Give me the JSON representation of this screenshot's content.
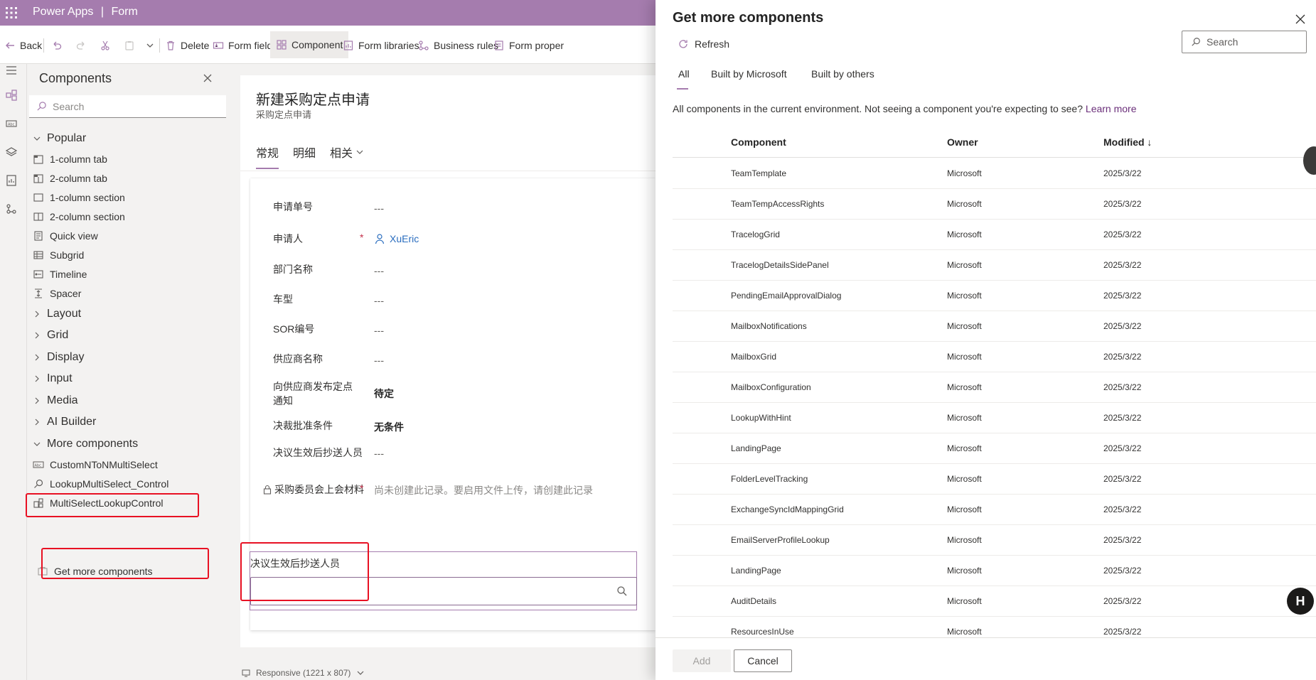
{
  "app": {
    "name": "Power Apps",
    "separator": "|",
    "section": "Form"
  },
  "toolbar": {
    "back": "Back",
    "delete": "Delete",
    "form_field": "Form field",
    "component": "Component",
    "form_libraries": "Form libraries",
    "business_rules": "Business rules",
    "form_properties": "Form proper"
  },
  "components_panel": {
    "title": "Components",
    "search_placeholder": "Search",
    "groups": {
      "popular": "Popular",
      "layout": "Layout",
      "grid": "Grid",
      "display": "Display",
      "input": "Input",
      "media": "Media",
      "ai_builder": "AI Builder",
      "more": "More components"
    },
    "popular_items": [
      "1-column tab",
      "2-column tab",
      "1-column section",
      "2-column section",
      "Quick view",
      "Subgrid",
      "Timeline",
      "Spacer"
    ],
    "more_items": [
      "CustomNToNMultiSelect",
      "LookupMultiSelect_Control",
      "MultiSelectLookupControl"
    ],
    "get_more": "Get more components"
  },
  "form": {
    "title": "新建采购定点申请",
    "subtitle": "采购定点申请",
    "tabs": [
      "常规",
      "明细",
      "相关"
    ],
    "fields": [
      {
        "label": "申请单号",
        "value": "---"
      },
      {
        "label": "申请人",
        "value": "XuEric"
      },
      {
        "label": "部门名称",
        "value": "---"
      },
      {
        "label": "车型",
        "value": "---"
      },
      {
        "label": "SOR编号",
        "value": "---"
      },
      {
        "label": "供应商名称",
        "value": "---"
      },
      {
        "label": "向供应商发布定点通知",
        "value": "待定"
      },
      {
        "label": "决裁批准条件",
        "value": "无条件"
      },
      {
        "label": "决议生效后抄送人员",
        "value": "---"
      },
      {
        "label": "采购委员会上会材料",
        "value": "尚未创建此记录。要启用文件上传，请创建此记录"
      }
    ],
    "required_mark": "*",
    "component_label": "决议生效后抄送人员",
    "responsive": "Responsive (1221 x 807)"
  },
  "dialog": {
    "title": "Get more components",
    "refresh": "Refresh",
    "search_placeholder": "Search",
    "tabs": [
      "All",
      "Built by Microsoft",
      "Built by others"
    ],
    "info": "All components in the current environment. Not seeing a component you're expecting to see?",
    "learn_more": "Learn more",
    "columns": {
      "component": "Component",
      "owner": "Owner",
      "modified": "Modified ↓"
    },
    "rows": [
      {
        "name": "TeamTemplate",
        "owner": "Microsoft",
        "modified": "2025/3/22"
      },
      {
        "name": "TeamTempAccessRights",
        "owner": "Microsoft",
        "modified": "2025/3/22"
      },
      {
        "name": "TracelogGrid",
        "owner": "Microsoft",
        "modified": "2025/3/22"
      },
      {
        "name": "TracelogDetailsSidePanel",
        "owner": "Microsoft",
        "modified": "2025/3/22"
      },
      {
        "name": "PendingEmailApprovalDialog",
        "owner": "Microsoft",
        "modified": "2025/3/22"
      },
      {
        "name": "MailboxNotifications",
        "owner": "Microsoft",
        "modified": "2025/3/22"
      },
      {
        "name": "MailboxGrid",
        "owner": "Microsoft",
        "modified": "2025/3/22"
      },
      {
        "name": "MailboxConfiguration",
        "owner": "Microsoft",
        "modified": "2025/3/22"
      },
      {
        "name": "LookupWithHint",
        "owner": "Microsoft",
        "modified": "2025/3/22"
      },
      {
        "name": "LandingPage",
        "owner": "Microsoft",
        "modified": "2025/3/22"
      },
      {
        "name": "FolderLevelTracking",
        "owner": "Microsoft",
        "modified": "2025/3/22"
      },
      {
        "name": "ExchangeSyncIdMappingGrid",
        "owner": "Microsoft",
        "modified": "2025/3/22"
      },
      {
        "name": "EmailServerProfileLookup",
        "owner": "Microsoft",
        "modified": "2025/3/22"
      },
      {
        "name": "LandingPage",
        "owner": "Microsoft",
        "modified": "2025/3/22"
      },
      {
        "name": "AuditDetails",
        "owner": "Microsoft",
        "modified": "2025/3/22"
      },
      {
        "name": "ResourcesInUse",
        "owner": "Microsoft",
        "modified": "2025/3/22"
      }
    ],
    "add": "Add",
    "cancel": "Cancel"
  },
  "fab_label": "H",
  "colors": {
    "brand": "#a57cae",
    "highlight": "#e81123",
    "link": "#6b2f7a"
  }
}
